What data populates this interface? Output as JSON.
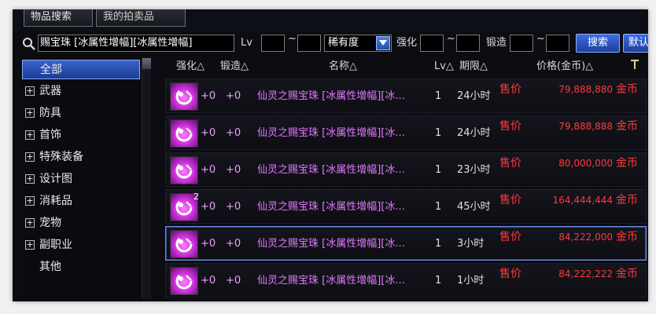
{
  "tabs": [
    "物品搜索",
    "我的拍卖品"
  ],
  "search": {
    "keyword": "赐宝珠 [冰属性增幅][冰属性增幅]",
    "lv_label": "Lv",
    "tilde": "~",
    "rarity": "稀有度",
    "enhance_label": "强化",
    "forge_label": "锻造",
    "search_button": "搜索",
    "default_button": "默认"
  },
  "categories": [
    {
      "label": "全部",
      "expandable": false,
      "active": true
    },
    {
      "label": "武器",
      "expandable": true
    },
    {
      "label": "防具",
      "expandable": true
    },
    {
      "label": "首饰",
      "expandable": true
    },
    {
      "label": "特殊装备",
      "expandable": true
    },
    {
      "label": "设计图",
      "expandable": true
    },
    {
      "label": "消耗品",
      "expandable": true
    },
    {
      "label": "宠物",
      "expandable": true
    },
    {
      "label": "副职业",
      "expandable": true
    },
    {
      "label": "其他",
      "expandable": false
    }
  ],
  "columns": {
    "enhance": "强化△",
    "forge": "锻造△",
    "name": "名称△",
    "lv": "Lv△",
    "period": "期限△",
    "price": "价格(金币)△"
  },
  "rows": [
    {
      "enhance": "+0",
      "forge": "+0",
      "name": "仙灵之赐宝珠 [冰属性增幅][冰...",
      "lv": "1",
      "period": "24小时",
      "sale": "售价",
      "price": "79,888,880",
      "currency": "金币",
      "stack": "",
      "selected": false
    },
    {
      "enhance": "+0",
      "forge": "+0",
      "name": "仙灵之赐宝珠 [冰属性增幅][冰...",
      "lv": "1",
      "period": "24小时",
      "sale": "售价",
      "price": "79,888,888",
      "currency": "金币",
      "stack": "",
      "selected": false
    },
    {
      "enhance": "+0",
      "forge": "+0",
      "name": "仙灵之赐宝珠 [冰属性增幅][冰...",
      "lv": "1",
      "period": "23小时",
      "sale": "售价",
      "price": "80,000,000",
      "currency": "金币",
      "stack": "",
      "selected": false
    },
    {
      "enhance": "+0",
      "forge": "+0",
      "name": "仙灵之赐宝珠 [冰属性增幅][冰...",
      "lv": "1",
      "period": "45小时",
      "sale": "售价",
      "price": "164,444,444",
      "currency": "金币",
      "stack": "2",
      "selected": false
    },
    {
      "enhance": "+0",
      "forge": "+0",
      "name": "仙灵之赐宝珠 [冰属性增幅][冰...",
      "lv": "1",
      "period": "3小时",
      "sale": "售价",
      "price": "84,222,000",
      "currency": "金币",
      "stack": "",
      "selected": true
    },
    {
      "enhance": "+0",
      "forge": "+0",
      "name": "仙灵之赐宝珠 [冰属性增幅][冰...",
      "lv": "1",
      "period": "1小时",
      "sale": "售价",
      "price": "84,222,222",
      "currency": "金币",
      "stack": "",
      "selected": false
    }
  ]
}
